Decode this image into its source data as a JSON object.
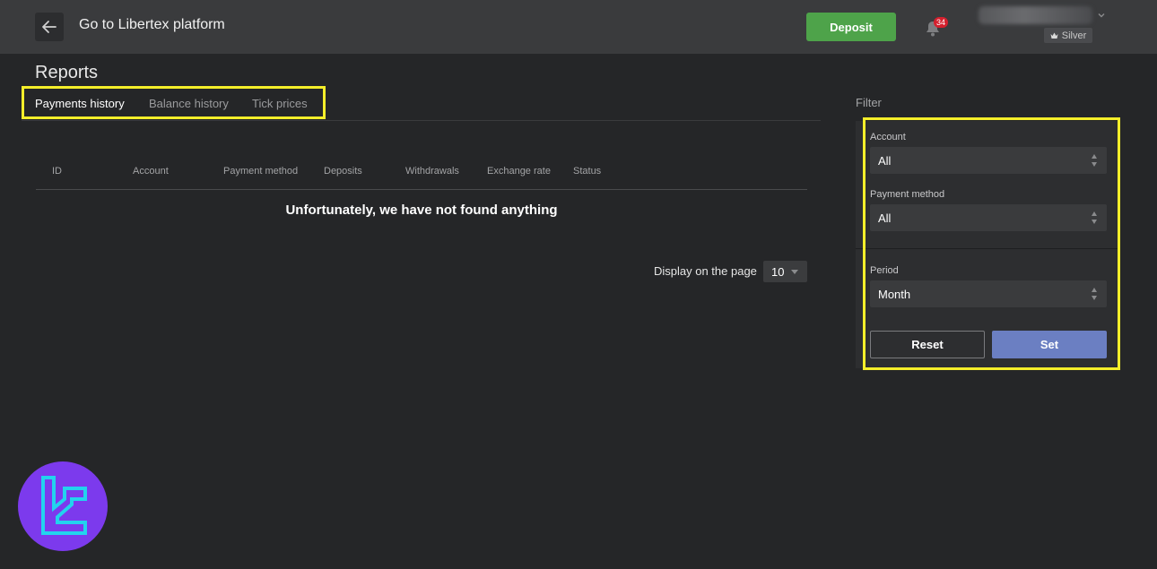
{
  "header": {
    "back_icon": "arrow-left-icon",
    "platform_link": "Go to Libertex platform",
    "deposit_label": "Deposit",
    "notifications_count": "34",
    "bell_icon": "bell-icon",
    "tier_icon": "crown-icon",
    "tier_label": "Silver"
  },
  "page": {
    "title": "Reports"
  },
  "tabs": [
    {
      "label": "Payments history",
      "active": true
    },
    {
      "label": "Balance history",
      "active": false
    },
    {
      "label": "Tick prices",
      "active": false
    }
  ],
  "table": {
    "columns": [
      "ID",
      "Account",
      "Payment method",
      "Deposits",
      "Withdrawals",
      "Exchange rate",
      "Status"
    ],
    "empty_message": "Unfortunately, we have not found anything"
  },
  "pagination": {
    "label": "Display on the page",
    "page_size": "10"
  },
  "filter": {
    "title": "Filter",
    "account_label": "Account",
    "account_value": "All",
    "payment_method_label": "Payment method",
    "payment_method_value": "All",
    "period_label": "Period",
    "period_value": "Month",
    "reset_label": "Reset",
    "set_label": "Set"
  },
  "colors": {
    "background": "#252628",
    "topbar": "#3a3b3d",
    "deposit_green": "#4ea34a",
    "set_blue": "#6b7fc2",
    "highlight_yellow": "#f4ee2a",
    "badge_red": "#d4202e",
    "logo_purple": "#7c3aed",
    "logo_cyan": "#22d3ee"
  }
}
